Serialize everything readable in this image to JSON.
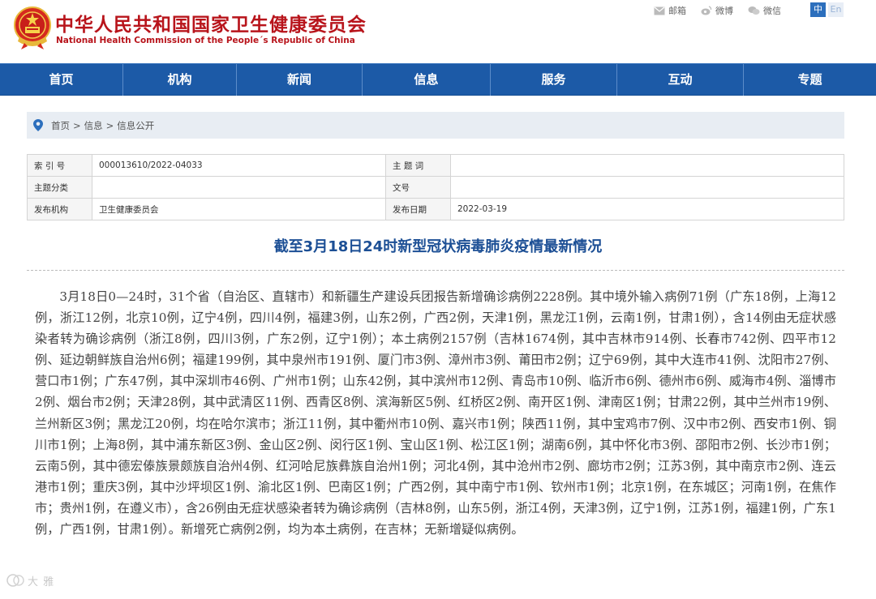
{
  "header": {
    "title_cn": "中华人民共和国国家卫生健康委员会",
    "title_en": "National Health Commission of the People´s Republic of China",
    "tools": [
      {
        "label": "邮箱",
        "icon": "mail-icon"
      },
      {
        "label": "微博",
        "icon": "weibo-icon"
      },
      {
        "label": "微信",
        "icon": "wechat-icon"
      }
    ],
    "lang_zh": "中",
    "lang_en": "En",
    "brand_color": "#b8141b",
    "nav_color": "#1c5aa7"
  },
  "nav": {
    "items": [
      "首页",
      "机构",
      "新闻",
      "信息",
      "服务",
      "互动",
      "专题"
    ]
  },
  "breadcrumb": {
    "items": [
      "首页",
      "信息",
      "信息公开"
    ],
    "separator": ">"
  },
  "meta": {
    "rows": [
      {
        "k1": "索 引 号",
        "v1": "000013610/2022-04033",
        "k2": "主 题 词",
        "v2": ""
      },
      {
        "k1": "主题分类",
        "v1": "",
        "k2": "文号",
        "v2": ""
      },
      {
        "k1": "发布机构",
        "v1": "卫生健康委员会",
        "k2": "发布日期",
        "v2": "2022-03-19"
      }
    ]
  },
  "article": {
    "title": "截至3月18日24时新型冠状病毒肺炎疫情最新情况",
    "paragraph": "3月18日0—24时，31个省（自治区、直辖市）和新疆生产建设兵团报告新增确诊病例2228例。其中境外输入病例71例（广东18例，上海12例，浙江12例，北京10例，辽宁4例，四川4例，福建3例，山东2例，广西2例，天津1例，黑龙江1例，云南1例，甘肃1例），含14例由无症状感染者转为确诊病例（浙江8例，四川3例，广东2例，辽宁1例）；本土病例2157例（吉林1674例，其中吉林市914例、长春市742例、四平市12例、延边朝鲜族自治州6例；福建199例，其中泉州市191例、厦门市3例、漳州市3例、莆田市2例；辽宁69例，其中大连市41例、沈阳市27例、营口市1例；广东47例，其中深圳市46例、广州市1例；山东42例，其中滨州市12例、青岛市10例、临沂市6例、德州市6例、威海市4例、淄博市2例、烟台市2例；天津28例，其中武清区11例、西青区8例、滨海新区5例、红桥区2例、南开区1例、津南区1例；甘肃22例，其中兰州市19例、兰州新区3例；黑龙江20例，均在哈尔滨市；浙江11例，其中衢州市10例、嘉兴市1例；陕西11例，其中宝鸡市7例、汉中市2例、西安市1例、铜川市1例；上海8例，其中浦东新区3例、金山区2例、闵行区1例、宝山区1例、松江区1例；湖南6例，其中怀化市3例、邵阳市2例、长沙市1例；云南5例，其中德宏傣族景颇族自治州4例、红河哈尼族彝族自治州1例；河北4例，其中沧州市2例、廊坊市2例；江苏3例，其中南京市2例、连云港市1例；重庆3例，其中沙坪坝区1例、渝北区1例、巴南区1例；广西2例，其中南宁市1例、钦州市1例；北京1例，在东城区；河南1例，在焦作市；贵州1例，在遵义市），含26例由无症状感染者转为确诊病例（吉林8例，山东5例，浙江4例，天津3例，辽宁1例，江苏1例，福建1例，广东1例，广西1例，甘肃1例）。新增死亡病例2例，均为本土病例，在吉林；无新增疑似病例。"
  },
  "watermark": {
    "text": "大 雅"
  }
}
